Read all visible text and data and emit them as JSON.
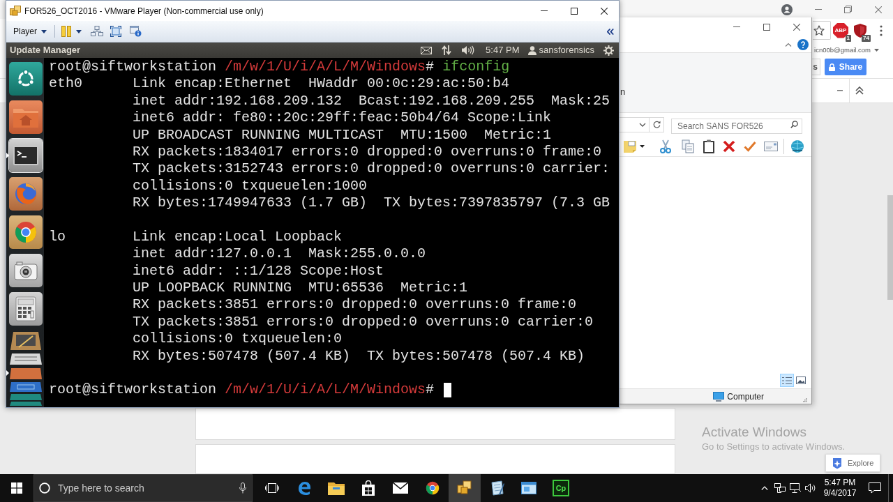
{
  "vmware_window": {
    "title": "FOR526_OCT2016 - VMware Player (Non-commercial use only)",
    "menu": "Player"
  },
  "ubuntu_panel": {
    "title": "Update Manager",
    "clock": "5:47 PM",
    "user": "sansforensics"
  },
  "launcher": [
    {
      "kind": "dash",
      "running": false
    },
    {
      "kind": "files",
      "running": false
    },
    {
      "kind": "terminal",
      "running": true
    },
    {
      "kind": "firefox",
      "running": false
    },
    {
      "kind": "chrome",
      "running": false
    },
    {
      "kind": "camera",
      "running": false
    },
    {
      "kind": "calculator",
      "running": false
    },
    {
      "kind": "stack",
      "running": true
    }
  ],
  "terminal": {
    "lines": [
      {
        "kind": "prompt",
        "user": "root@siftworkstation",
        "path": "/m/w/1/U/i/A/L/M/Windows",
        "symbol": "#",
        "command": "ifconfig"
      },
      {
        "kind": "output",
        "iface": "eth0",
        "text": "Link encap:Ethernet  HWaddr 00:0c:29:ac:50:b4"
      },
      {
        "kind": "output",
        "text": "inet addr:192.168.209.132  Bcast:192.168.209.255  Mask:25"
      },
      {
        "kind": "output",
        "text": "inet6 addr: fe80::20c:29ff:feac:50b4/64 Scope:Link"
      },
      {
        "kind": "output",
        "text": "UP BROADCAST RUNNING MULTICAST  MTU:1500  Metric:1"
      },
      {
        "kind": "output",
        "text": "RX packets:1834017 errors:0 dropped:0 overruns:0 frame:0"
      },
      {
        "kind": "output",
        "text": "TX packets:3152743 errors:0 dropped:0 overruns:0 carrier:"
      },
      {
        "kind": "output",
        "text": "collisions:0 txqueuelen:1000"
      },
      {
        "kind": "output",
        "text": "RX bytes:1749947633 (1.7 GB)  TX bytes:7397835797 (7.3 GB"
      },
      {
        "kind": "blank"
      },
      {
        "kind": "output",
        "iface": "lo",
        "text": "Link encap:Local Loopback"
      },
      {
        "kind": "output",
        "text": "inet addr:127.0.0.1  Mask:255.0.0.0"
      },
      {
        "kind": "output",
        "text": "inet6 addr: ::1/128 Scope:Host"
      },
      {
        "kind": "output",
        "text": "UP LOOPBACK RUNNING  MTU:65536  Metric:1"
      },
      {
        "kind": "output",
        "text": "RX packets:3851 errors:0 dropped:0 overruns:0 frame:0"
      },
      {
        "kind": "output",
        "text": "TX packets:3851 errors:0 dropped:0 overruns:0 carrier:0"
      },
      {
        "kind": "output",
        "text": "collisions:0 txqueuelen:0"
      },
      {
        "kind": "output",
        "text": "RX bytes:507478 (507.4 KB)  TX bytes:507478 (507.4 KB)"
      },
      {
        "kind": "blank"
      },
      {
        "kind": "prompt",
        "user": "root@siftworkstation",
        "path": "/m/w/1/U/i/A/L/M/Windows",
        "symbol": "#",
        "cursor": true
      }
    ]
  },
  "explorer_window": {
    "ribbon_fragment": "n",
    "search": {
      "placeholder": "Search SANS FOR526"
    },
    "view_buttons": [
      {
        "kind": "details",
        "selected": true
      },
      {
        "kind": "preview",
        "selected": false
      }
    ],
    "status": "Computer"
  },
  "chrome_window": {
    "extensions": [
      {
        "kind": "stop-sign",
        "label": "ABP",
        "badge": "1"
      },
      {
        "kind": "shield",
        "badge": "74"
      }
    ],
    "account": "icn00b@gmail.com",
    "partial_button": "s",
    "share_button": "Share"
  },
  "activation_notice": {
    "title": "Activate Windows",
    "text": "Go to Settings to activate Windows."
  },
  "explore_button": "Explore",
  "taskbar": {
    "search": {
      "placeholder": "Type here to search"
    },
    "apps": [
      {
        "kind": "edge",
        "active": false
      },
      {
        "kind": "explorer",
        "active": false
      },
      {
        "kind": "store",
        "active": false
      },
      {
        "kind": "mail",
        "active": false
      },
      {
        "kind": "chrome",
        "active": false
      },
      {
        "kind": "vmware",
        "active": true
      },
      {
        "kind": "notepad",
        "active": false
      },
      {
        "kind": "window",
        "active": false
      },
      {
        "kind": "cp",
        "label": "Cp",
        "active": false
      }
    ],
    "time": "5:47 PM",
    "date": "9/4/2017"
  }
}
